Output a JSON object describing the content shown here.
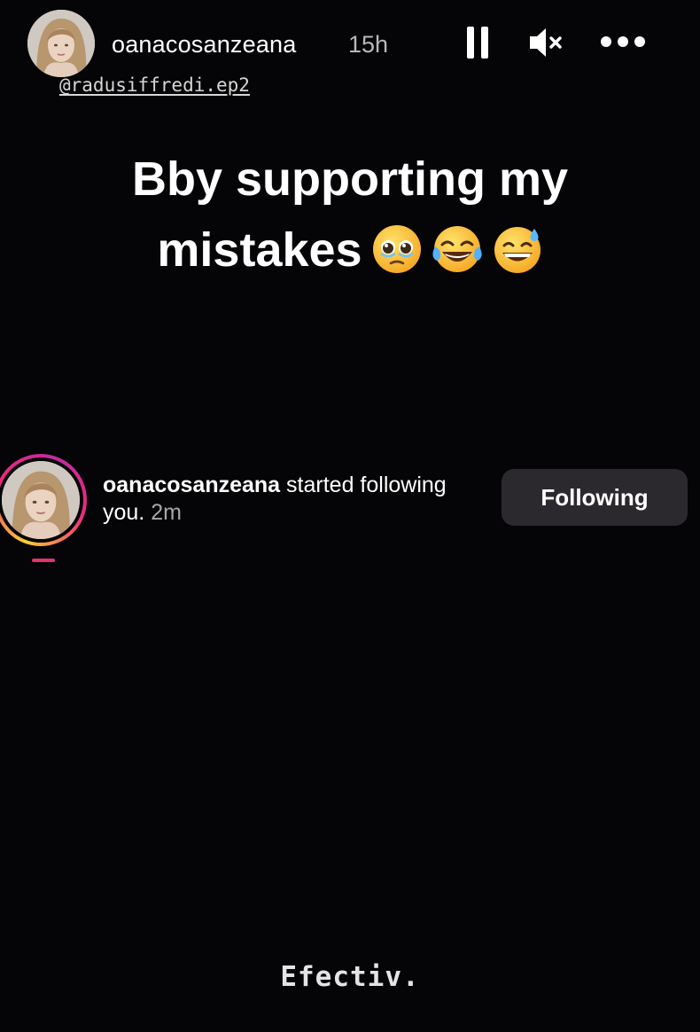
{
  "story": {
    "username": "oanacosanzeana",
    "time_ago": "15h",
    "mention": "@radusiffredi.ep2",
    "caption_line_1": "Bby supporting my",
    "caption_line_2": "mistakes",
    "caption_emojis": [
      "face-holding-back-tears",
      "face-with-tears-of-joy",
      "grinning-face-with-sweat"
    ],
    "footer_text": "Efectiv."
  },
  "controls": {
    "pause_icon": "pause-icon",
    "mute_icon": "speaker-muted-icon",
    "more_icon": "more-options-icon"
  },
  "notification": {
    "username": "oanacosanzeana",
    "action": " started following you.",
    "time": "2m",
    "button_label": "Following"
  },
  "colors": {
    "background": "#050406",
    "button_bg": "#2c292e",
    "ring_start": "#f9ce34",
    "ring_end": "#ee2a7b"
  }
}
